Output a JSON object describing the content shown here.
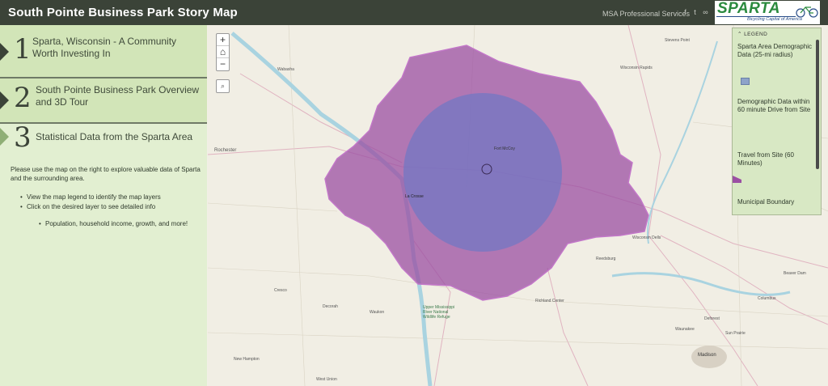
{
  "header": {
    "title": "South Pointe Business Park Story Map",
    "org": "MSA Professional Services",
    "icons": [
      "facebook-icon",
      "twitter-icon",
      "link-icon"
    ],
    "logo": {
      "word": "SPARTA",
      "tagline": "Bicycling Capital of America"
    }
  },
  "sidebar": {
    "sections": [
      {
        "number": "1",
        "title": "Sparta, Wisconsin - A Community Worth Investing In"
      },
      {
        "number": "2",
        "title": "South Pointe Business Park Overview and 3D Tour"
      },
      {
        "number": "3",
        "title": "Statistical Data from the Sparta Area"
      }
    ],
    "content": {
      "intro": "Please use the map on the right to explore valuable data of Sparta and the surrounding area.",
      "bullets": [
        "View the map legend to identify the map layers",
        "Click on the desired layer to see detailed info"
      ],
      "subbullet": "Population, household income, growth, and more!"
    }
  },
  "map": {
    "zoom_in": "+",
    "zoom_out": "−",
    "home": "⌂",
    "search": "⌕",
    "labels": [
      "Stevens Point",
      "Wabasha",
      "Wisconsin Rapids",
      "Rochester",
      "Fort McCoy",
      "La Crosse",
      "Wisconsin Dells",
      "Reedsburg",
      "Beaver Dam",
      "Cresco",
      "Decorah",
      "Waukon",
      "Richland Center",
      "Columbus",
      "Upper Mississippi River National Wildlife Refuge",
      "Waunakee",
      "Deforest",
      "Sun Prairie",
      "Madison",
      "New Hampton",
      "West Union"
    ],
    "colors": {
      "travel": "#9b4fa3",
      "radius": "#6d78c4",
      "water": "#a9d3e0"
    }
  },
  "legend": {
    "header": "LEGEND",
    "items": [
      {
        "label": "Sparta Area Demographic Data (25-mi radius)",
        "color": "#8ea3c9"
      },
      {
        "label": "Demographic Data within 60 minute Drive from Site",
        "color": ""
      },
      {
        "label": "Travel from Site (60 Minutes)",
        "color": "#9b4fa3"
      },
      {
        "label": "Municipal Boundary",
        "color": ""
      }
    ]
  }
}
